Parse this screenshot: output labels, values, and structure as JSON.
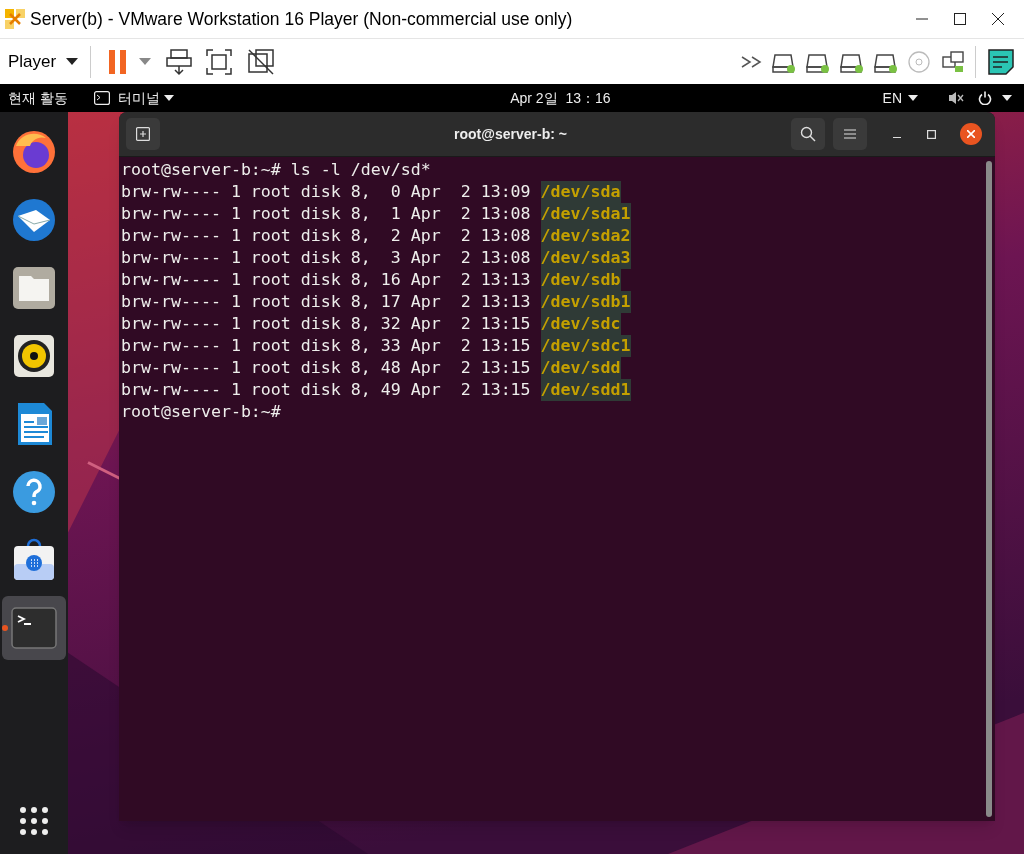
{
  "window": {
    "title": "Server(b) - VMware Workstation 16 Player (Non-commercial use only)"
  },
  "toolbar": {
    "player_menu": "Player",
    "devices": [
      {
        "kind": "disk",
        "connected": true
      },
      {
        "kind": "disk",
        "connected": true
      },
      {
        "kind": "disk",
        "connected": true
      },
      {
        "kind": "disk",
        "connected": true
      },
      {
        "kind": "cd",
        "connected": false
      },
      {
        "kind": "network",
        "connected": true
      }
    ]
  },
  "top_bar": {
    "activities": "현재 활동",
    "app_menu": "터미널",
    "clock": "Apr 2일  13：16",
    "input_source": "EN"
  },
  "dock": [
    {
      "kind": "browser",
      "selected": false,
      "running": false
    },
    {
      "kind": "mail",
      "selected": false,
      "running": false
    },
    {
      "kind": "files",
      "selected": false,
      "running": false
    },
    {
      "kind": "music",
      "selected": false,
      "running": false
    },
    {
      "kind": "document",
      "selected": false,
      "running": false
    },
    {
      "kind": "help",
      "selected": false,
      "running": false
    },
    {
      "kind": "software",
      "selected": false,
      "running": false
    },
    {
      "kind": "terminal",
      "selected": true,
      "running": true
    }
  ],
  "terminal": {
    "title": "root@server-b: ~",
    "lines": [
      {
        "kind": "plain",
        "text": "root@server-b:~# ls -l /dev/sd*"
      },
      {
        "kind": "entry",
        "text": "brw-rw---- 1 root disk 8,  0 Apr  2 13:09 ",
        "device": "/dev/sda"
      },
      {
        "kind": "entry",
        "text": "brw-rw---- 1 root disk 8,  1 Apr  2 13:08 ",
        "device": "/dev/sda1"
      },
      {
        "kind": "entry",
        "text": "brw-rw---- 1 root disk 8,  2 Apr  2 13:08 ",
        "device": "/dev/sda2"
      },
      {
        "kind": "entry",
        "text": "brw-rw---- 1 root disk 8,  3 Apr  2 13:08 ",
        "device": "/dev/sda3"
      },
      {
        "kind": "entry",
        "text": "brw-rw---- 1 root disk 8, 16 Apr  2 13:13 ",
        "device": "/dev/sdb"
      },
      {
        "kind": "entry",
        "text": "brw-rw---- 1 root disk 8, 17 Apr  2 13:13 ",
        "device": "/dev/sdb1"
      },
      {
        "kind": "entry",
        "text": "brw-rw---- 1 root disk 8, 32 Apr  2 13:15 ",
        "device": "/dev/sdc"
      },
      {
        "kind": "entry",
        "text": "brw-rw---- 1 root disk 8, 33 Apr  2 13:15 ",
        "device": "/dev/sdc1"
      },
      {
        "kind": "entry",
        "text": "brw-rw---- 1 root disk 8, 48 Apr  2 13:15 ",
        "device": "/dev/sdd"
      },
      {
        "kind": "entry",
        "text": "brw-rw---- 1 root disk 8, 49 Apr  2 13:15 ",
        "device": "/dev/sdd1"
      },
      {
        "kind": "plain",
        "text": "root@server-b:~#"
      }
    ]
  }
}
